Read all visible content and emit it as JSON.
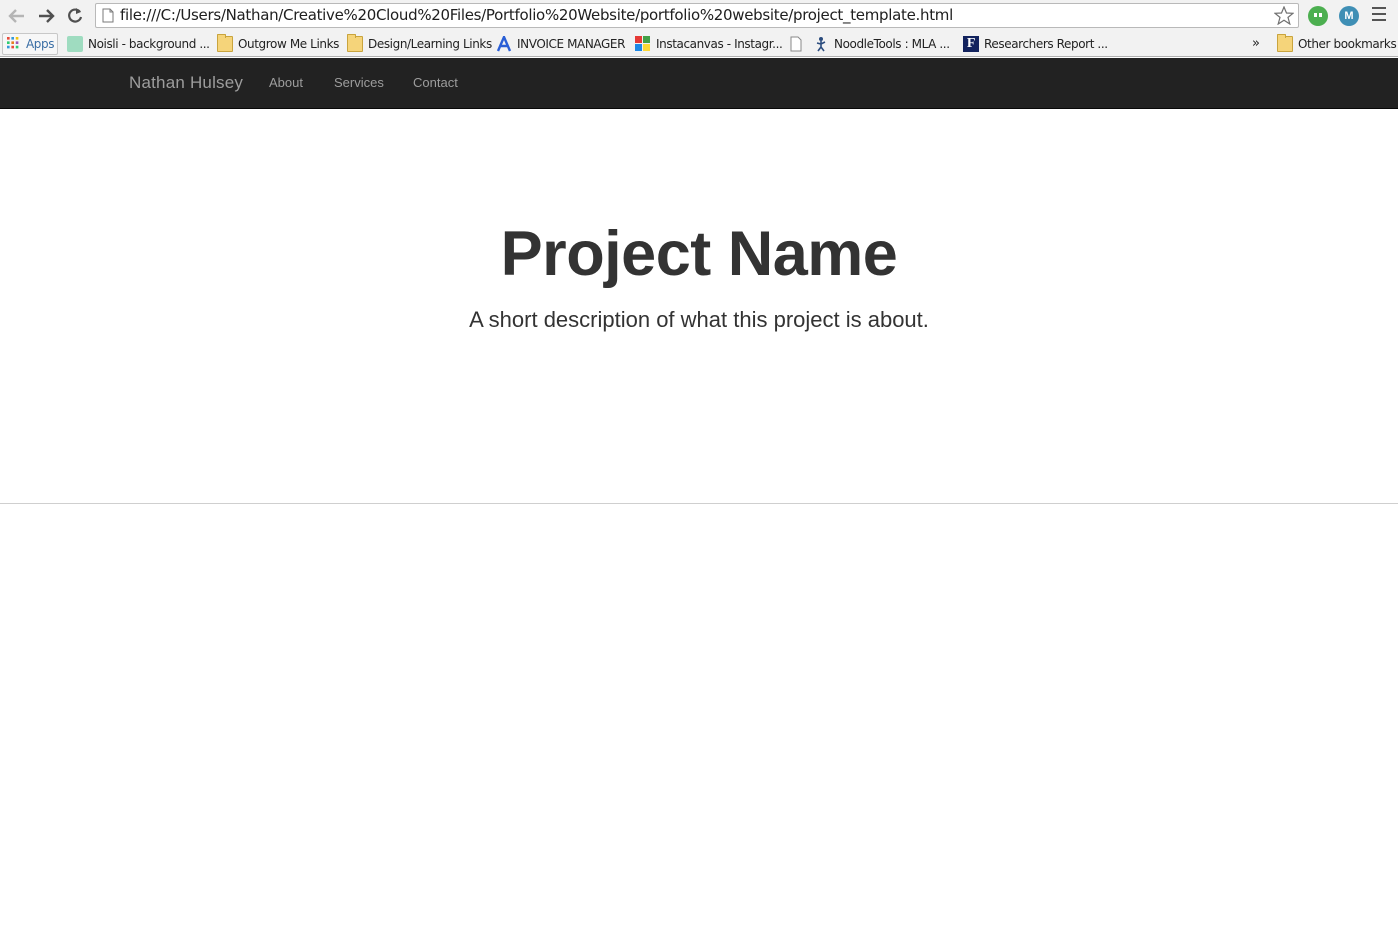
{
  "browser": {
    "url": "file:///C:/Users/Nathan/Creative%20Cloud%20Files/Portfolio%20Website/portfolio%20website/project_template.html",
    "bookmarks": [
      {
        "label": "Apps",
        "icon": "apps-grid-icon"
      },
      {
        "label": "Noisli - background ...",
        "icon": "noisli-icon"
      },
      {
        "label": "Outgrow Me Links",
        "icon": "folder-icon"
      },
      {
        "label": "Design/Learning Links",
        "icon": "folder-icon"
      },
      {
        "label": "INVOICE MANAGER",
        "icon": "invoice-a-icon"
      },
      {
        "label": "Instacanvas - Instagr...",
        "icon": "instacanvas-icon"
      },
      {
        "label": "",
        "icon": "blank-page-icon"
      },
      {
        "label": "NoodleTools : MLA ...",
        "icon": "noodletools-icon"
      },
      {
        "label": "Researchers Report ...",
        "icon": "f-logo-icon"
      }
    ],
    "overflow_label": "»",
    "other_bookmarks": "Other bookmarks"
  },
  "site": {
    "brand": "Nathan Hulsey",
    "nav": [
      "About",
      "Services",
      "Contact"
    ]
  },
  "hero": {
    "title": "Project Name",
    "subtitle": "A short description of what this project is about."
  },
  "colors": {
    "navbar_bg": "#222222",
    "navbar_text": "#9d9d9d",
    "heading_text": "#333333"
  }
}
